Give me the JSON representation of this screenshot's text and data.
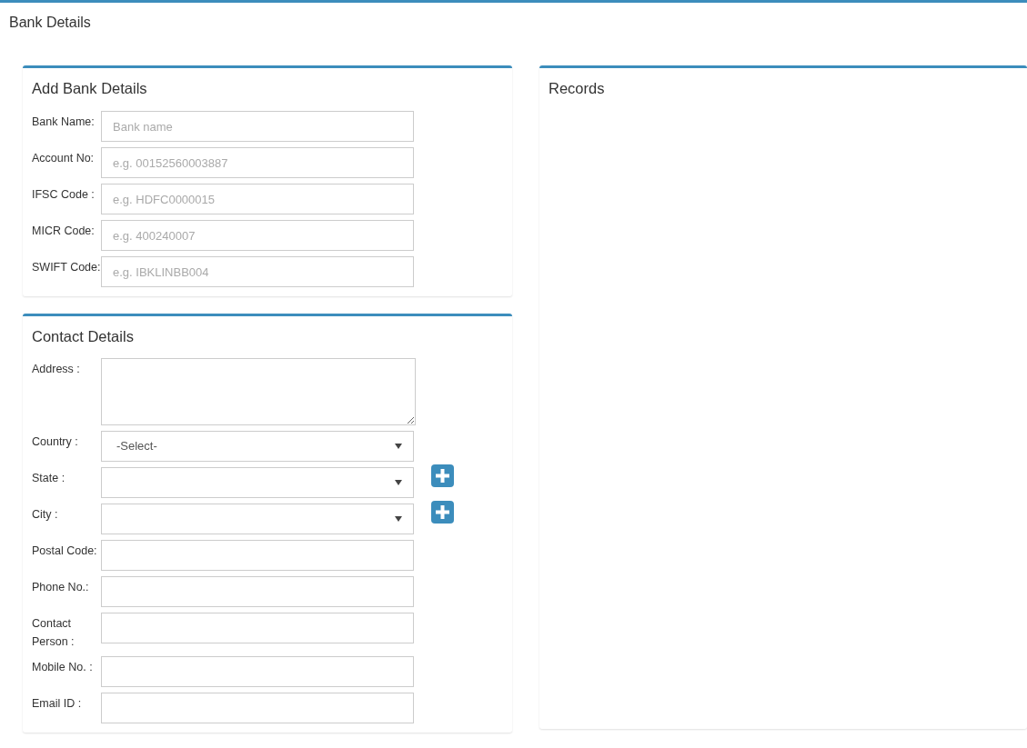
{
  "page_title": "Bank Details",
  "bank_panel": {
    "title": "Add Bank Details",
    "fields": [
      {
        "label": "Bank Name:",
        "kind": "text",
        "placeholder": "Bank name"
      },
      {
        "label": "Account No:",
        "kind": "text",
        "placeholder": "e.g. 00152560003887"
      },
      {
        "label": "IFSC Code :",
        "kind": "text",
        "placeholder": "e.g. HDFC0000015"
      },
      {
        "label": "MICR Code:",
        "kind": "text",
        "placeholder": "e.g. 400240007"
      },
      {
        "label": "SWIFT Code:",
        "kind": "text",
        "placeholder": "e.g. IBKLINBB004"
      }
    ]
  },
  "contact_panel": {
    "title": "Contact Details",
    "fields": [
      {
        "label": "Address :",
        "kind": "textarea"
      },
      {
        "label": "Country :",
        "kind": "select",
        "value": "-Select-",
        "add_button": false
      },
      {
        "label": "State :",
        "kind": "select",
        "add_button": true
      },
      {
        "label": "City :",
        "kind": "select",
        "add_button": true
      },
      {
        "label": "Postal Code:",
        "kind": "text"
      },
      {
        "label": "Phone No.:",
        "kind": "text"
      },
      {
        "label": "Contact Person :",
        "kind": "text"
      },
      {
        "label": "Mobile No. :",
        "kind": "text"
      },
      {
        "label": "Email ID :",
        "kind": "text"
      }
    ]
  },
  "records_panel": {
    "title": "Records"
  }
}
